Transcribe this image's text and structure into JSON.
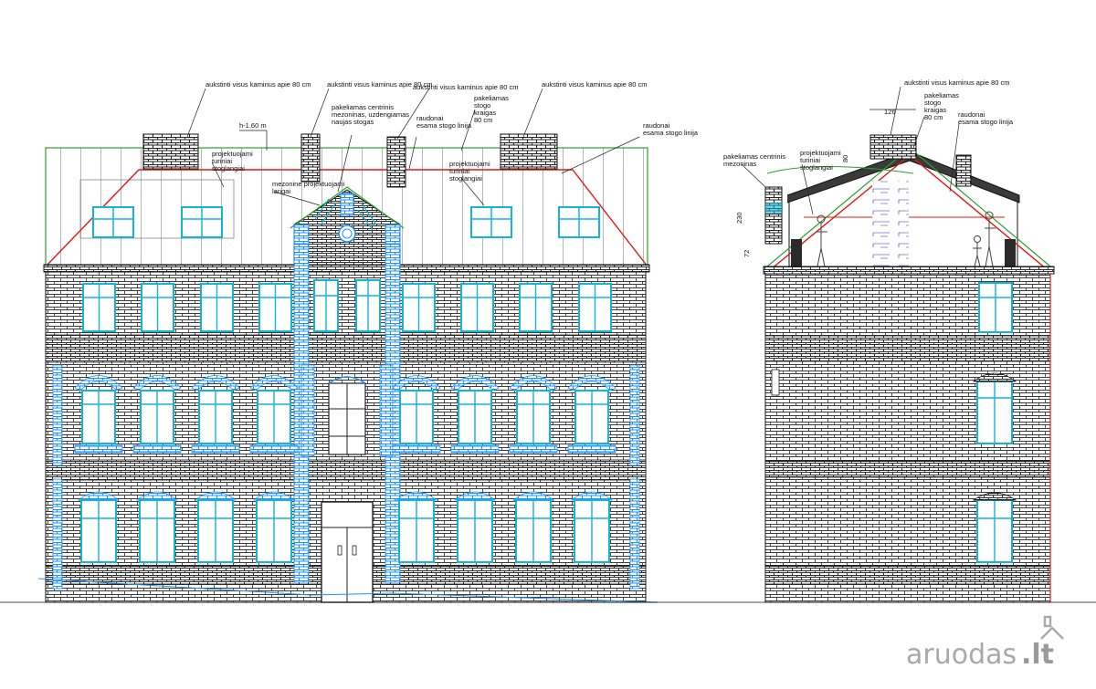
{
  "annotations": {
    "front_chimney_left": "aukstinti visus kaminus apie 80 cm",
    "front_chimney_mid": "aukstinti visus kaminus apie 80 cm",
    "front_chimney_mid2": "aukstinti visus kaminus apie 80 cm",
    "front_chimney_right": "aukstinti visus kaminus apie 80 cm",
    "height_note": "h-1.60 m",
    "dormers_left": [
      "projektuojami",
      "turiniai",
      "stoglangiai"
    ],
    "mezonine_raise": [
      "pakeliamas centrinis",
      "mezoninas, uzdengiamas",
      "naujas stogas"
    ],
    "mezonine_windows": [
      "mezonine projektuojami",
      "langai"
    ],
    "red_line_front": [
      "raudonai",
      "esama stogo linija"
    ],
    "ridge_front": [
      "pakeliamas",
      "stogo",
      "kraigas",
      "80 cm"
    ],
    "dormers_mid": [
      "projektuojami",
      "turiniai",
      "stoglangiai"
    ],
    "red_line_front_right": [
      "raudonai",
      "esama stogo linija"
    ],
    "side_chimney": "aukstinti visus kaminus apie 80 cm",
    "side_ridge": [
      "pakeliamas",
      "stogo",
      "kraigas",
      "80 cm"
    ],
    "side_red_line": [
      "raudonai",
      "esama stogo linija"
    ],
    "side_mezonine": [
      "pakeliamas centrinis",
      "mezoninas"
    ],
    "side_dormers": [
      "projektuojami",
      "turiniai",
      "stoglangiai"
    ]
  },
  "dimensions": {
    "side_width": "126",
    "side_height": "230",
    "side_small": "80",
    "side_base": "72"
  },
  "watermark": {
    "brand": "aruodas",
    "tld": ".lt"
  },
  "colors": {
    "brick": "#3a3a3a",
    "window": "#12b5d6",
    "highlight_brick": "#1e90ff",
    "existing_roof": "#e01818",
    "new_roof": "#2ca02c"
  }
}
